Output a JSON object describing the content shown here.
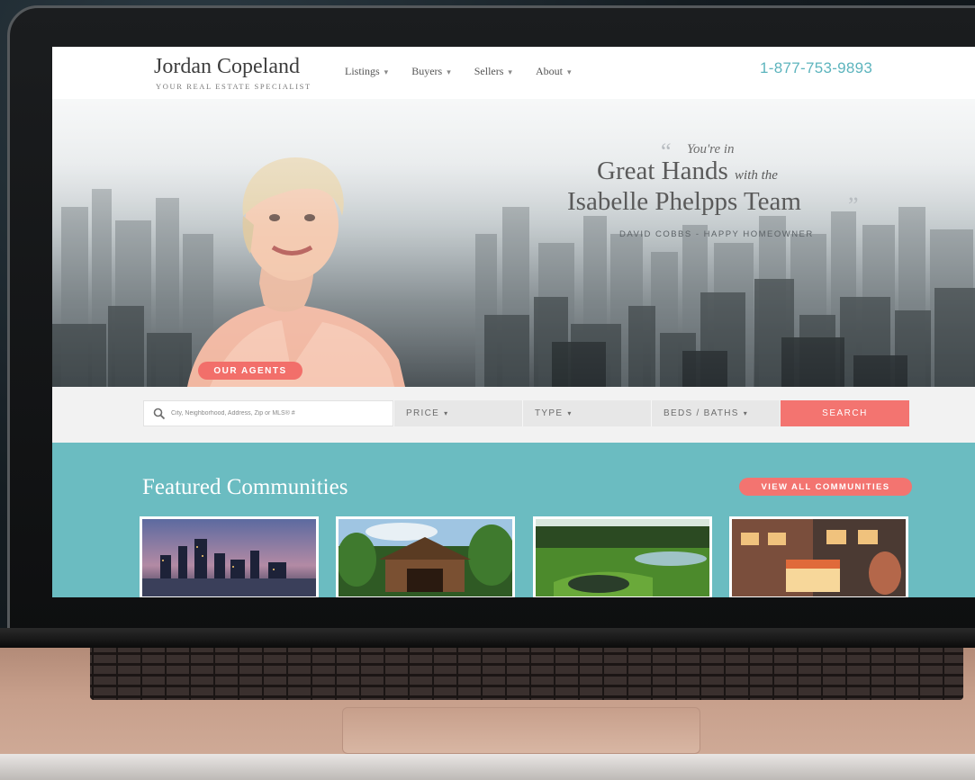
{
  "site": {
    "logo_name": "Jordan Copeland",
    "logo_tagline": "YOUR REAL ESTATE SPECIALIST",
    "phone": "1-877-753-9893"
  },
  "nav": {
    "items": [
      {
        "label": "Listings"
      },
      {
        "label": "Buyers"
      },
      {
        "label": "Sellers"
      },
      {
        "label": "About"
      }
    ],
    "chevron_icon": "chevron-down-icon"
  },
  "hero": {
    "quote_open": "“",
    "quote_close": "”",
    "line1": "You're in",
    "line2_main": "Great Hands",
    "line2_small": "with the",
    "line3": "Isabelle Phelpps Team",
    "author": "DAVID COBBS - HAPPY HOMEOWNER",
    "agents_button": "OUR AGENTS"
  },
  "search": {
    "placeholder": "City, Neighborhood, Address, Zip or MLS® #",
    "icon": "search-icon",
    "filters": [
      {
        "label": "PRICE"
      },
      {
        "label": "TYPE"
      },
      {
        "label": "BEDS / BATHS"
      }
    ],
    "button": "SEARCH"
  },
  "featured": {
    "title": "Featured Communities",
    "view_all": "VIEW ALL COMMUNITIES",
    "cards": [
      {
        "image": "city-skyline-at-dusk"
      },
      {
        "image": "covered-bridge-in-forest"
      },
      {
        "image": "golf-course-with-pond"
      },
      {
        "image": "storefronts-at-evening"
      }
    ]
  },
  "colors": {
    "accent": "#f37470",
    "teal": "#6bbcc1",
    "phone": "#5cb4bd"
  }
}
